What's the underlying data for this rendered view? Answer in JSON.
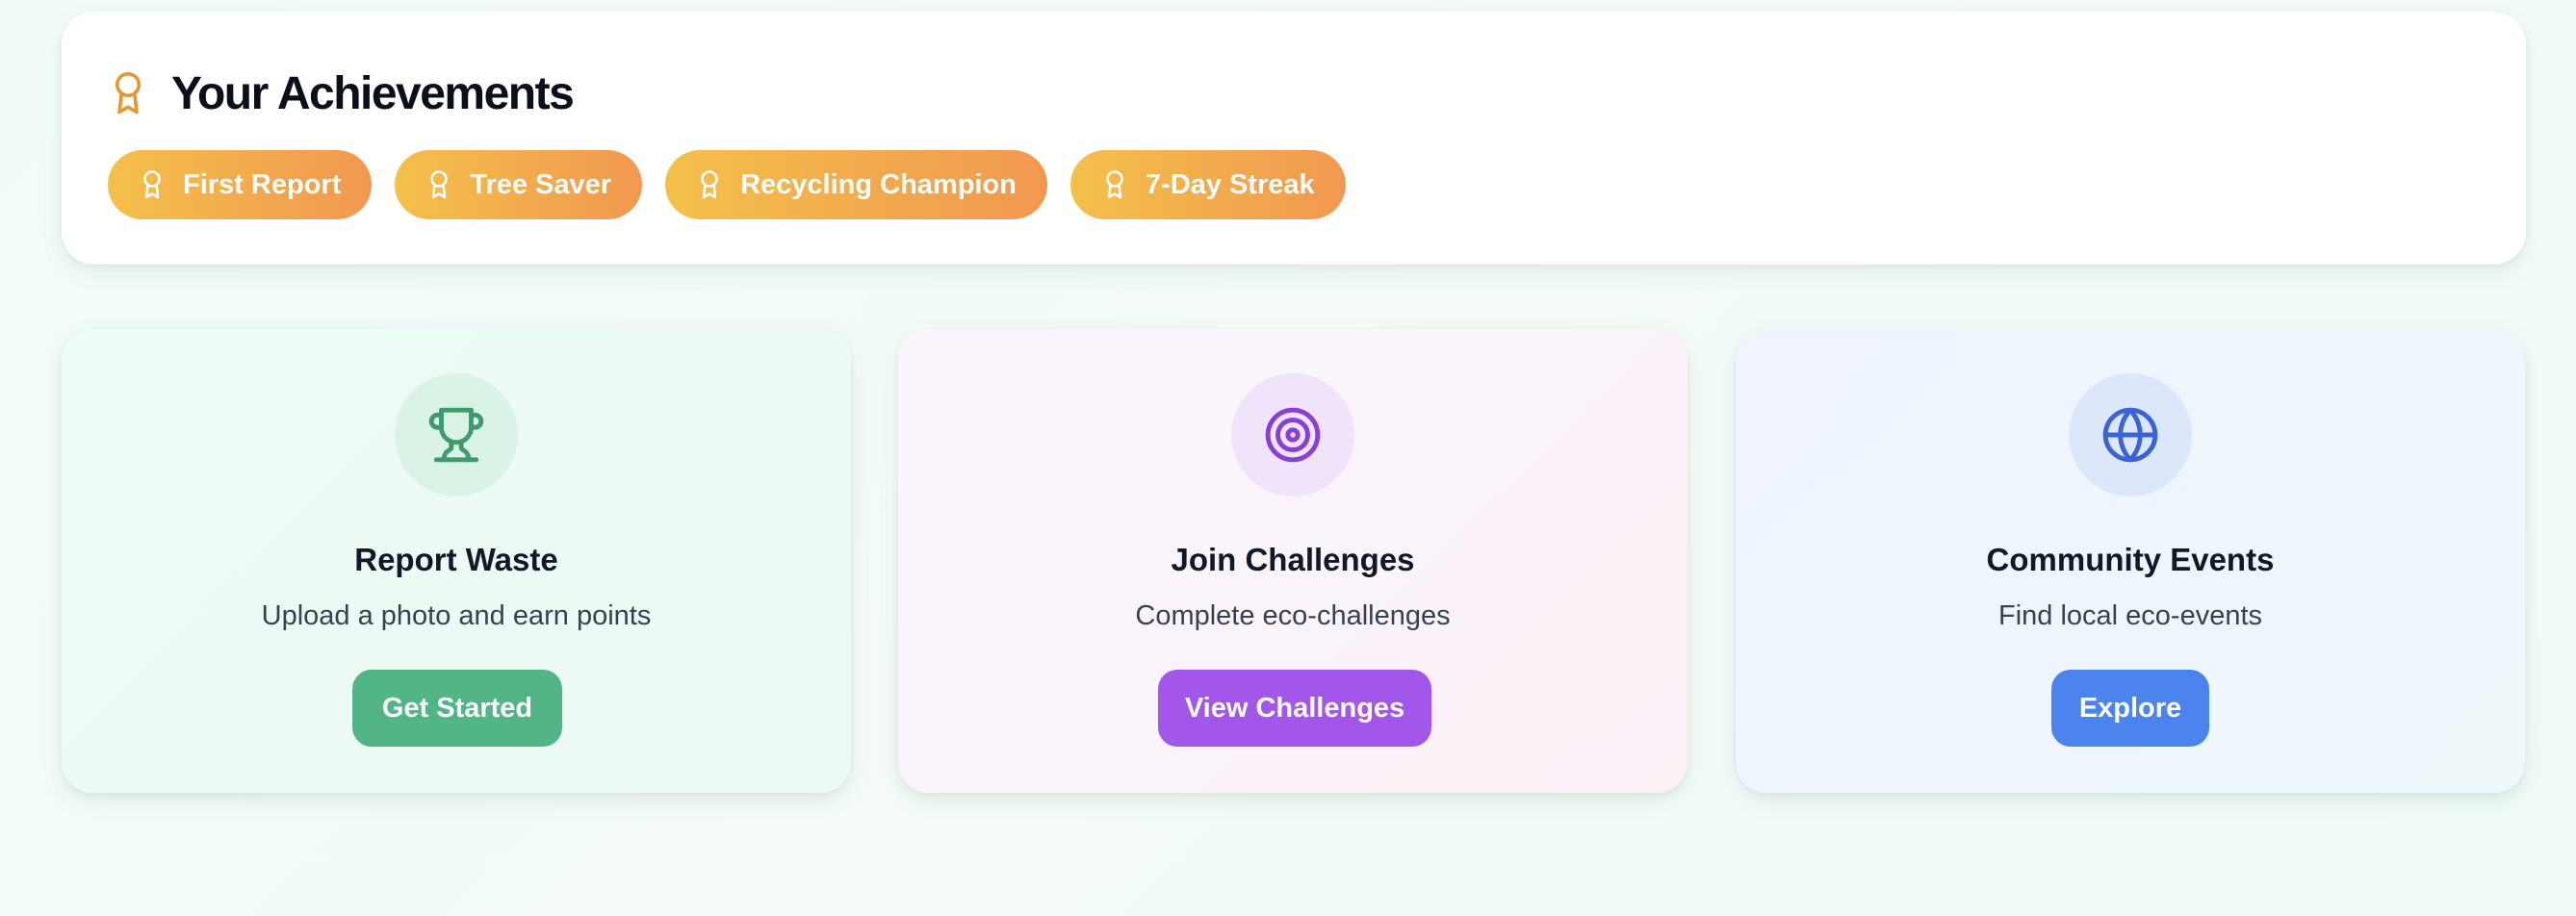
{
  "achievements": {
    "title": "Your Achievements",
    "icon": "award-icon",
    "badges": [
      {
        "label": "First Report",
        "icon": "award-icon"
      },
      {
        "label": "Tree Saver",
        "icon": "award-icon"
      },
      {
        "label": "Recycling Champion",
        "icon": "award-icon"
      },
      {
        "label": "7-Day Streak",
        "icon": "award-icon"
      }
    ]
  },
  "cards": [
    {
      "title": "Report Waste",
      "description": "Upload a photo and earn points",
      "button": "Get Started",
      "icon": "trophy-icon",
      "accent": "#52b587"
    },
    {
      "title": "Join Challenges",
      "description": "Complete eco-challenges",
      "button": "View Challenges",
      "icon": "target-icon",
      "accent": "#a356ea"
    },
    {
      "title": "Community Events",
      "description": "Find local eco-events",
      "button": "Explore",
      "icon": "globe-icon",
      "accent": "#4c84ee"
    }
  ],
  "colors": {
    "badge_gradient_start": "#f4c04a",
    "badge_gradient_end": "#f19850",
    "award_icon": "#e8962e"
  }
}
